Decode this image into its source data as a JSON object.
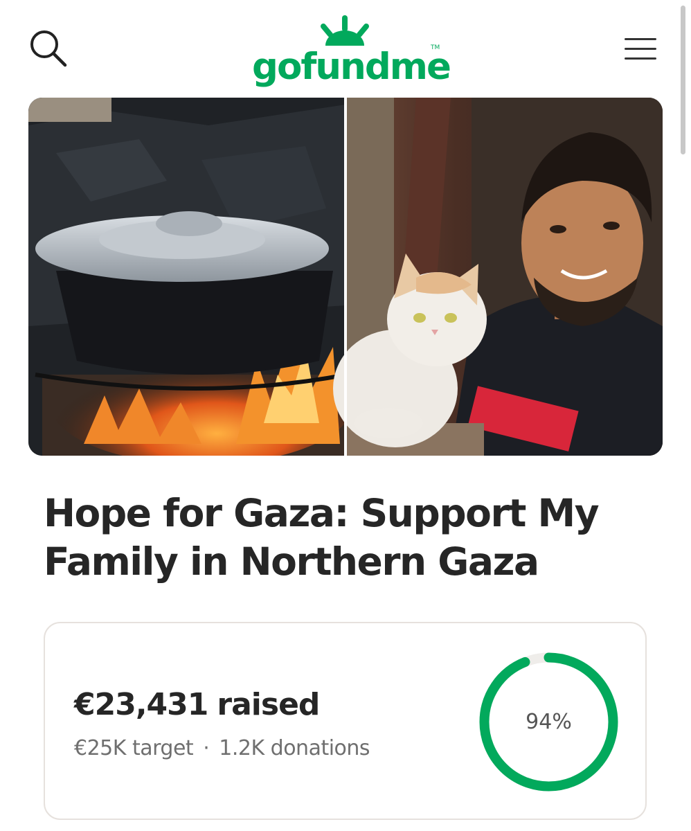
{
  "header": {
    "logo_text": "gofundme",
    "logo_tm": "TM",
    "search_icon": "search-icon",
    "menu_icon": "hamburger-menu-icon",
    "brand_color": "#02a95c"
  },
  "hero": {
    "left_photo": "cooking-pot-over-fire",
    "right_photo": "man-with-white-cat"
  },
  "campaign": {
    "title": "Hope for Gaza: Support My Family in Northern Gaza"
  },
  "progress": {
    "raised_amount": "€23,431",
    "raised_word": "raised",
    "target": "€25K target",
    "separator": "·",
    "donations": "1.2K donations",
    "percent_label": "94%",
    "percent_value": 94,
    "ring_color": "#02a95c",
    "ring_track_color": "#efedea"
  }
}
